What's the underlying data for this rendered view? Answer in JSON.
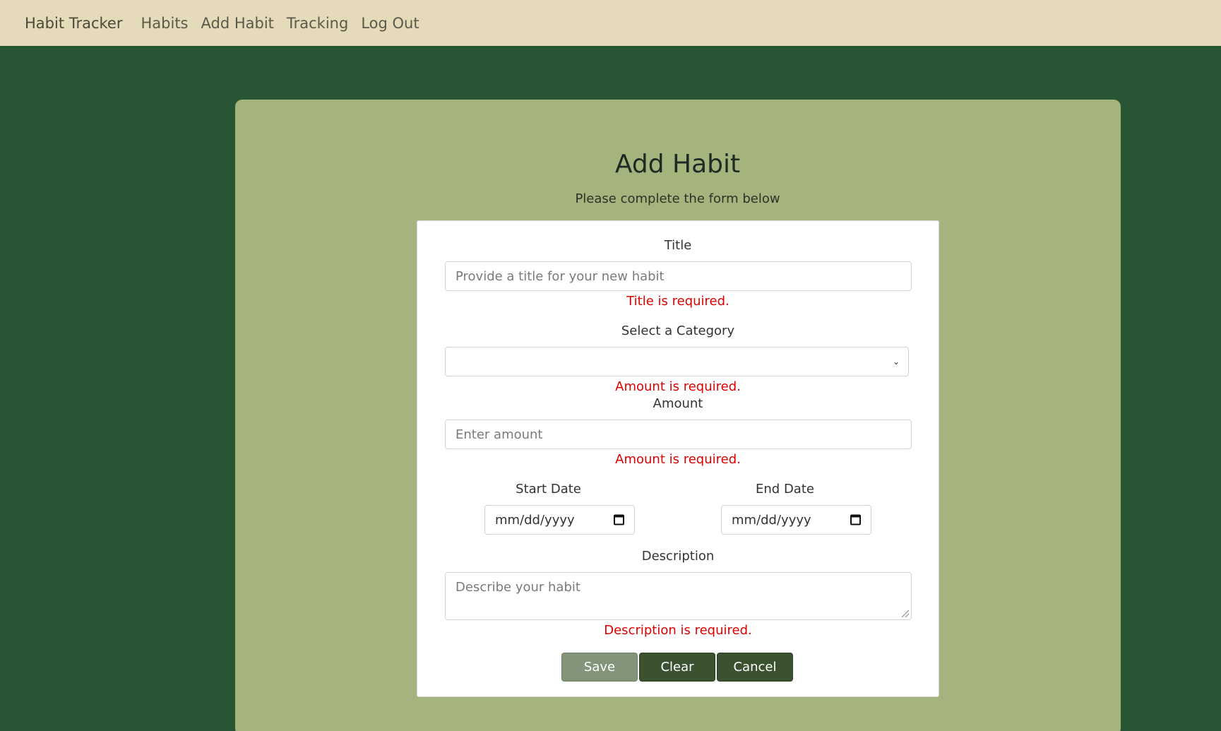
{
  "nav": {
    "brand": "Habit Tracker",
    "links": [
      "Habits",
      "Add Habit",
      "Tracking",
      "Log Out"
    ]
  },
  "page": {
    "title": "Add Habit",
    "subtitle": "Please complete the form below"
  },
  "form": {
    "title": {
      "label": "Title",
      "placeholder": "Provide a title for your new habit",
      "error": "Title is required."
    },
    "category": {
      "label": "Select a Category",
      "selected": "",
      "error": "Amount is required."
    },
    "amount": {
      "label": "Amount",
      "placeholder": "Enter amount",
      "error": "Amount is required."
    },
    "start_date": {
      "label": "Start Date",
      "placeholder": "mm/dd/yyyy"
    },
    "end_date": {
      "label": "End Date",
      "placeholder": "mm/dd/yyyy"
    },
    "description": {
      "label": "Description",
      "placeholder": "Describe your habit",
      "error": "Description is required."
    }
  },
  "buttons": {
    "save": "Save",
    "clear": "Clear",
    "cancel": "Cancel"
  },
  "colors": {
    "nav_bg": "#e5dab9",
    "page_bg": "#285533",
    "panel_bg": "#a4b47c",
    "error": "#e00000",
    "save_btn": "#829479",
    "dark_btn": "#3b5230"
  }
}
